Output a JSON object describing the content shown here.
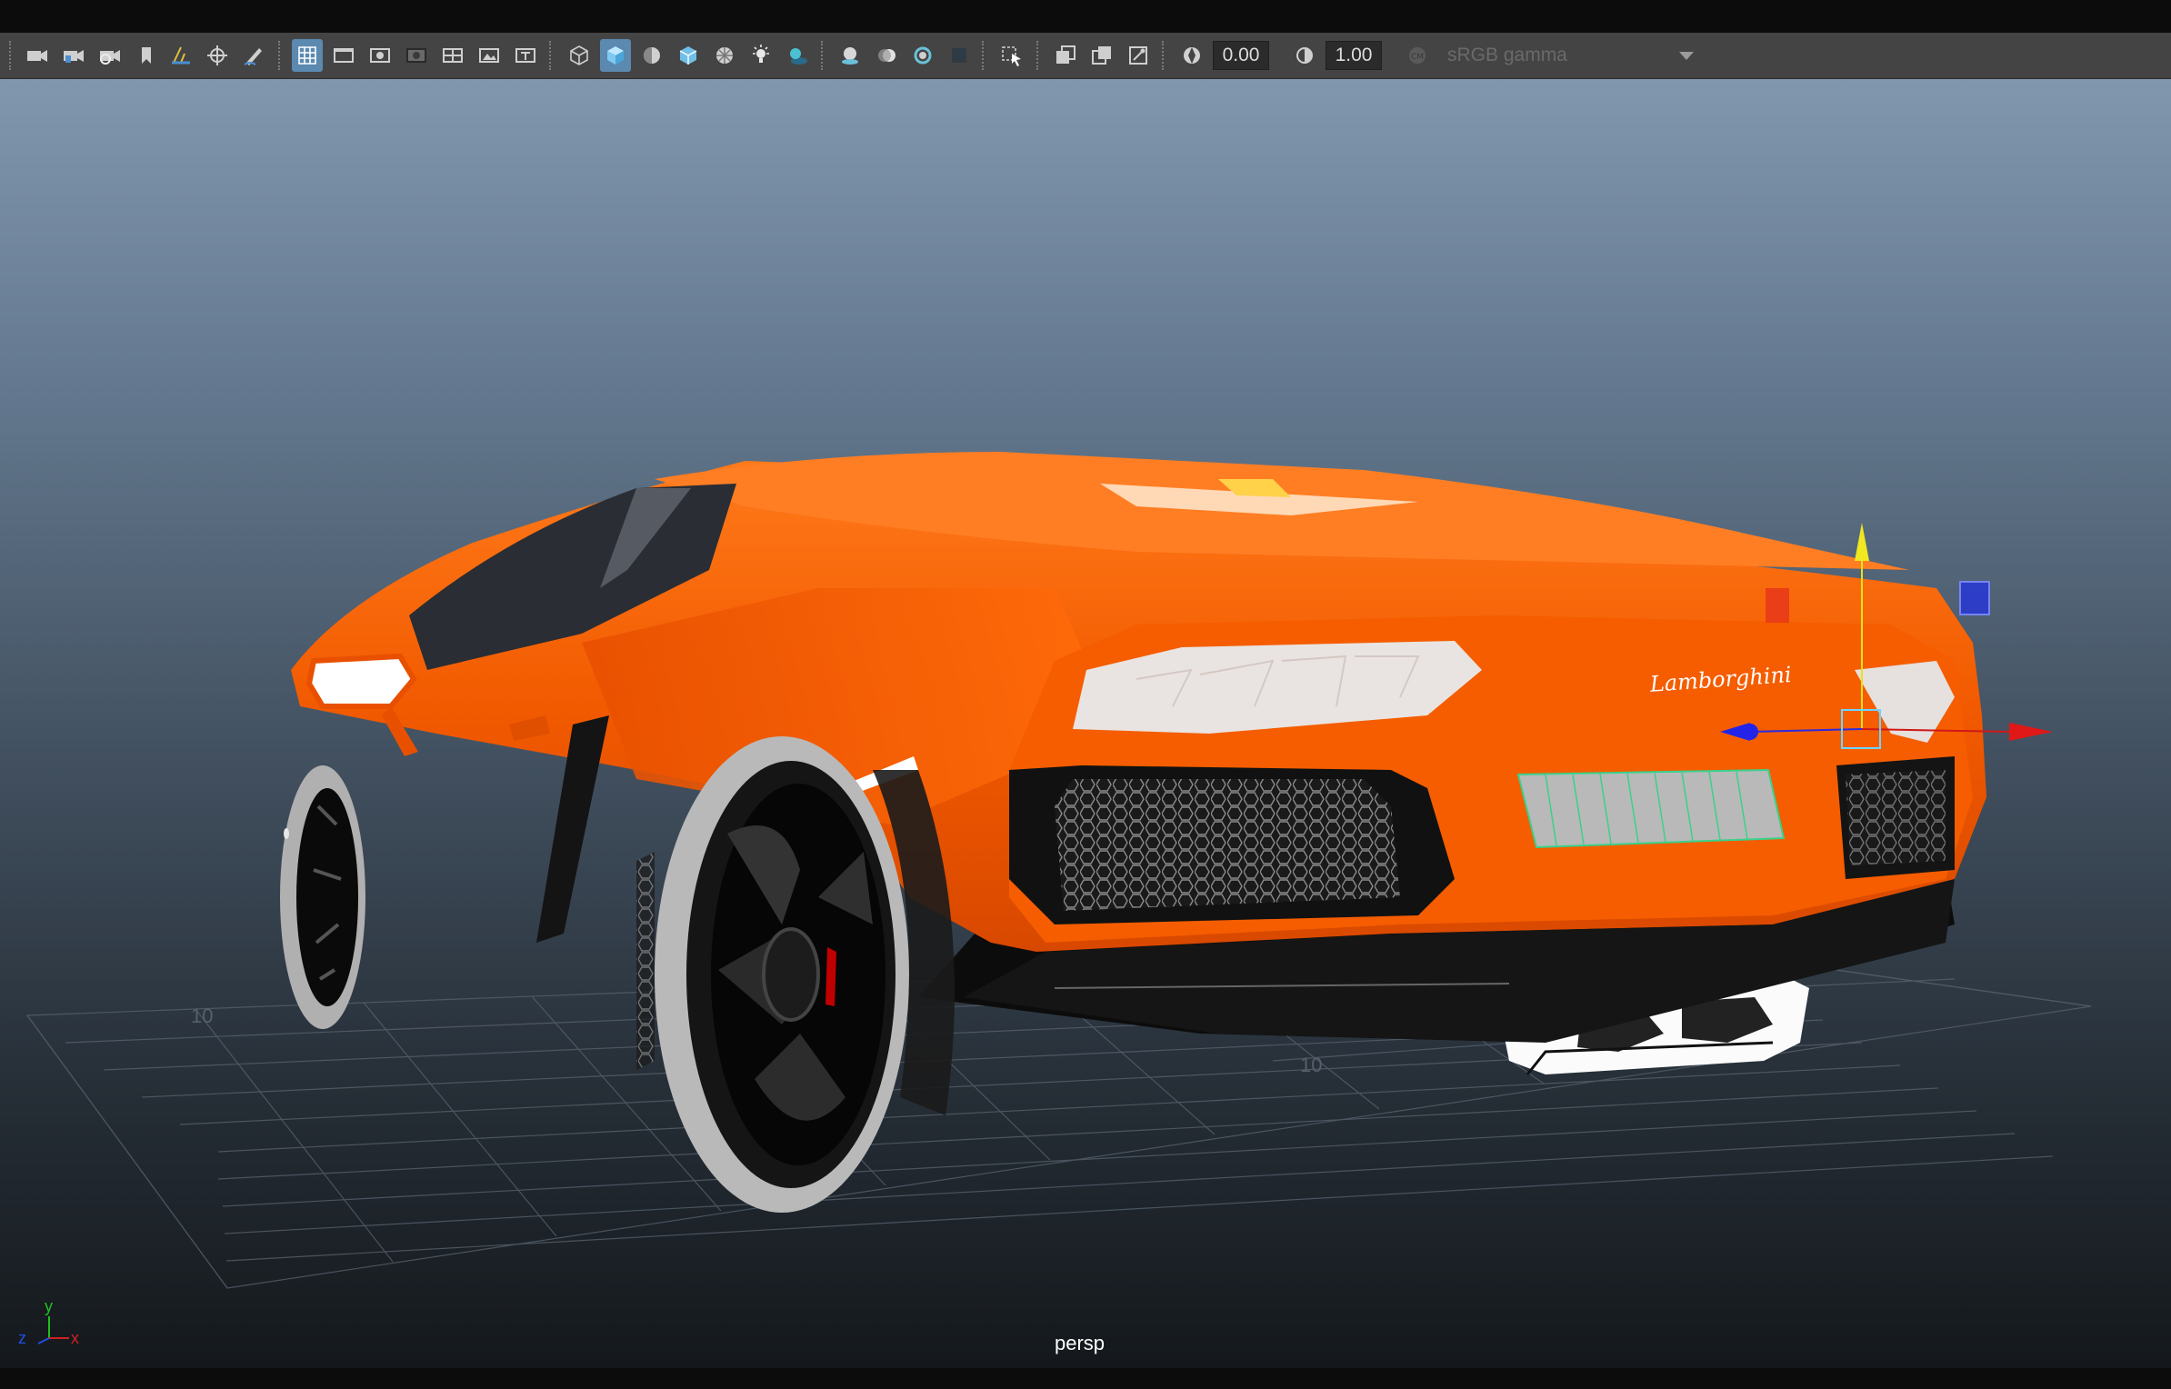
{
  "toolbar": {
    "icons": [
      "select-camera-icon",
      "camera-attributes-icon",
      "camera-tools-icon",
      "bookmark-icon",
      "image-plane-icon",
      "2d-pan-zoom-icon",
      "grease-pencil-icon",
      "grid-icon",
      "film-gate-icon",
      "resolution-gate-icon",
      "gate-mask-icon",
      "field-chart-icon",
      "safe-action-icon",
      "safe-title-icon",
      "wireframe-icon",
      "smooth-shade-icon",
      "default-material-icon",
      "wireframe-on-shaded-icon",
      "textured-icon",
      "use-all-lights-icon",
      "shadows-icon",
      "screen-space-ao-icon",
      "motion-blur-icon",
      "multisample-aa-icon",
      "depth-of-field-icon",
      "isolate-select-icon",
      "xray-icon",
      "xray-active-components-icon",
      "xray-joints-icon",
      "exposure-icon",
      "gamma-icon",
      "color-management-icon"
    ],
    "exposure_value": "0.00",
    "gamma_value": "1.00",
    "view_transform": "sRGB gamma",
    "accent_color": "#5b89b0"
  },
  "viewport": {
    "camera_label": "persp",
    "grid_label_left": "10",
    "grid_label_right": "10",
    "brand_badge": "Lamborghini",
    "axis": {
      "y": "y",
      "z": "z",
      "x": "x"
    },
    "body_color": "#f25a00"
  }
}
